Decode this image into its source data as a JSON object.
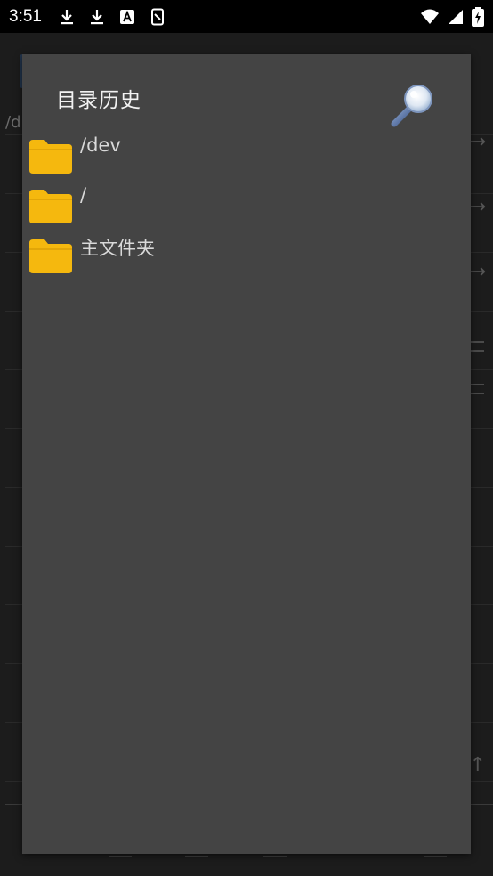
{
  "status_bar": {
    "time": "3:51",
    "icons": [
      "download-icon",
      "download-icon",
      "text-a-icon",
      "screenshot-icon"
    ],
    "right_icons": [
      "wifi-icon",
      "signal-icon",
      "battery-icon"
    ]
  },
  "background": {
    "path_text": "/d",
    "colors": {
      "toolbar_button": "#23364f"
    }
  },
  "dialog": {
    "title": "目录历史",
    "search_icon": "magnifier-icon",
    "items": [
      {
        "label": "/dev",
        "icon": "folder-icon"
      },
      {
        "label": "/",
        "icon": "folder-icon"
      },
      {
        "label": "主文件夹",
        "icon": "folder-icon"
      }
    ],
    "colors": {
      "background": "#444444",
      "folder": "#f5b80e"
    }
  }
}
